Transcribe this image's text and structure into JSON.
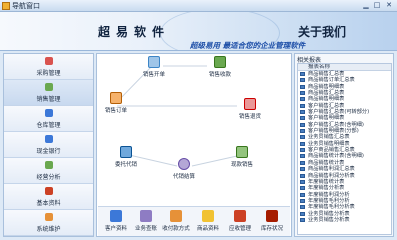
{
  "window": {
    "title": "导航窗口",
    "min_glyph": "▁",
    "max_glyph": "□",
    "close_glyph": "✕"
  },
  "banner": {
    "product_name": "超易软件",
    "about_link": "关于我们",
    "slogan": "超级易用 最适合您的企业管理软件"
  },
  "sidebar": {
    "items": [
      {
        "label": "采购管理",
        "icon": "purchase-icon",
        "color": "#d9534f"
      },
      {
        "label": "销售管理",
        "icon": "sales-icon",
        "color": "#6aa84f"
      },
      {
        "label": "仓库管理",
        "icon": "warehouse-icon",
        "color": "#3c78d8"
      },
      {
        "label": "现金银行",
        "icon": "cash-bank-icon",
        "color": "#3c78d8"
      },
      {
        "label": "经营分析",
        "icon": "analysis-icon",
        "color": "#6aa84f"
      },
      {
        "label": "基本资料",
        "icon": "basic-data-icon",
        "color": "#cc4125"
      },
      {
        "label": "系统维护",
        "icon": "system-maintenance-icon",
        "color": "#e69138"
      }
    ],
    "active_index": 1
  },
  "flow": {
    "sales_order": "销售订单",
    "sales_shipment": "销售开单",
    "sales_receipt": "销售收款",
    "sales_return": "销售退货",
    "consignment": "委托代销",
    "consignment_settlement": "代销结算",
    "cash_receipt": "现款销售"
  },
  "bottom_tools": [
    {
      "label": "客户资料",
      "icon": "customer-icon",
      "color": "#3c78d8"
    },
    {
      "label": "业务查账",
      "icon": "account-query-icon",
      "color": "#8e7cc3"
    },
    {
      "label": "收付款方式",
      "icon": "payment-method-icon",
      "color": "#e69138"
    },
    {
      "label": "商品资料",
      "icon": "product-icon",
      "color": "#f1c232"
    },
    {
      "label": "应收管理",
      "icon": "receivable-icon",
      "color": "#cc4125"
    },
    {
      "label": "库存状况",
      "icon": "inventory-icon",
      "color": "#a61c00"
    }
  ],
  "report_panel": {
    "title": "相关报表",
    "column_header": "报表名称",
    "rows": [
      "商品销售汇总表",
      "商品销售订单汇总表",
      "商品销售明细表",
      "商品销售汇总表",
      "商品销售明细表",
      "客户销售汇总表",
      "客户销售汇总表(可转部分)",
      "客户销售明细表",
      "客户销售汇总表(含明细)",
      "客户销售明细表(分部)",
      "业务员销售汇总表",
      "业务员销售明细表",
      "客户商品销售汇总表",
      "商品销售统计表(含明细)",
      "商品销售统计表",
      "商品销售利润汇总表",
      "商品销售利润分析表",
      "年度销售统计表",
      "年度销售分析表",
      "年度销售利润分析",
      "年度销售毛利分析",
      "年度销售毛利分析表",
      "业务员销售分析表",
      "业务员销售分析表"
    ]
  }
}
